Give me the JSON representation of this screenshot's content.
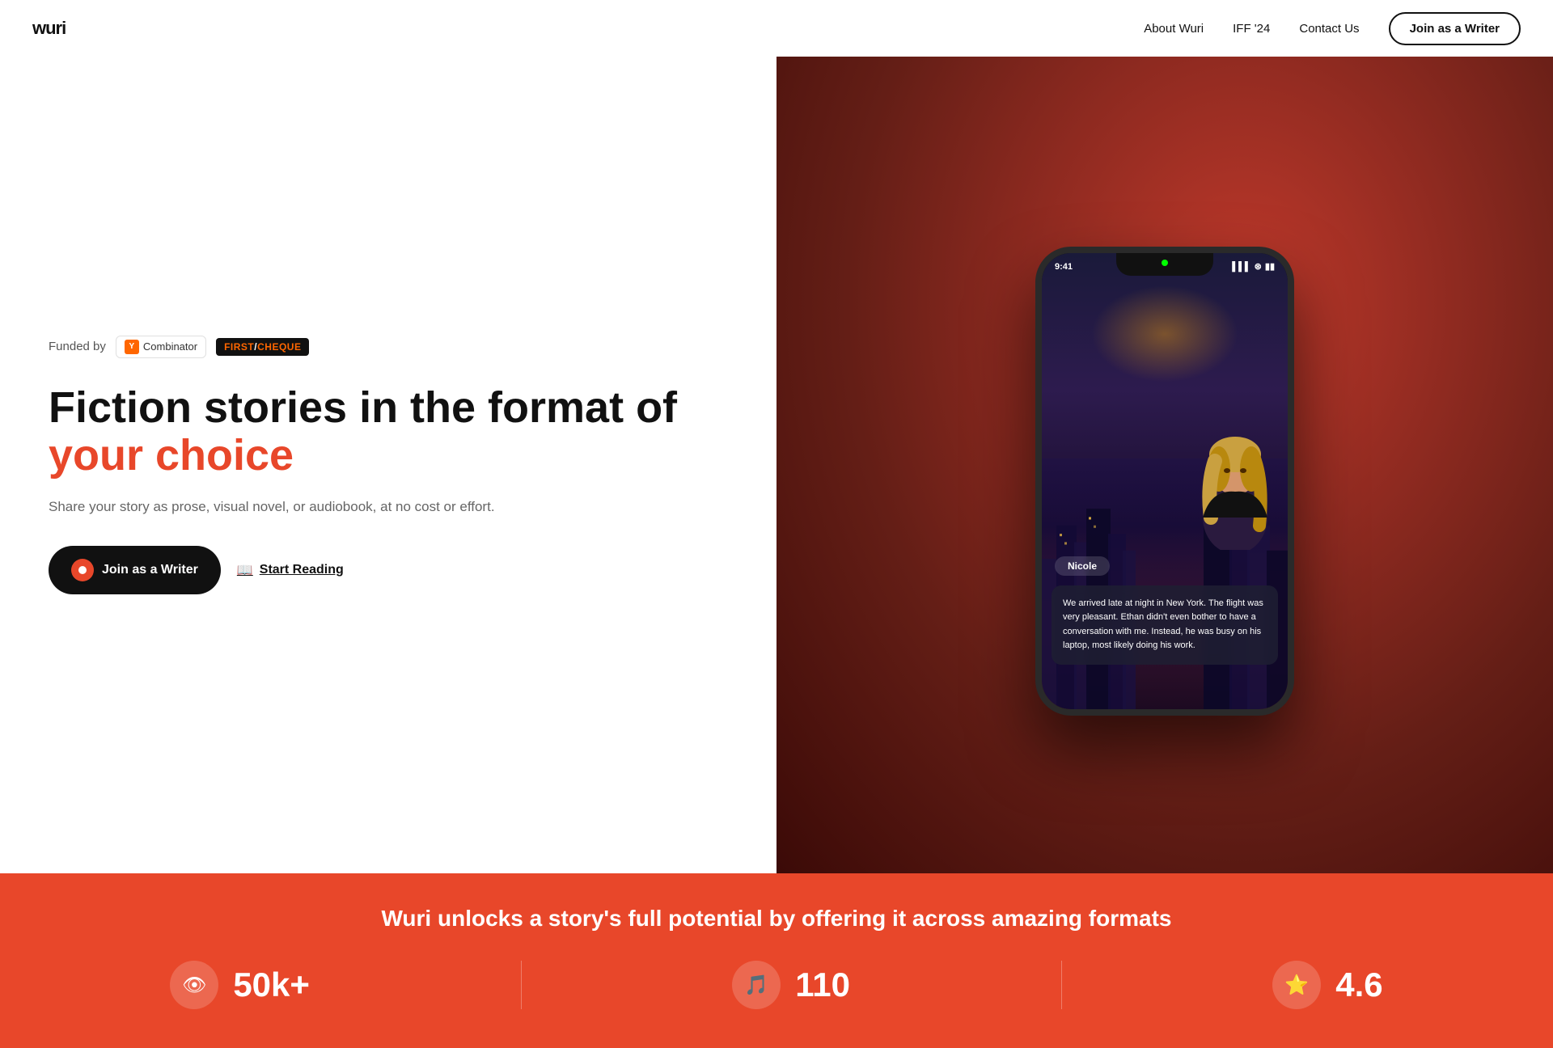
{
  "nav": {
    "logo": "wuri",
    "links": [
      {
        "label": "About Wuri",
        "href": "#"
      },
      {
        "label": "IFF '24",
        "href": "#"
      },
      {
        "label": "Contact Us",
        "href": "#"
      }
    ],
    "cta": "Join as a Writer"
  },
  "hero": {
    "funded_label": "Funded by",
    "yc_label": "Combinator",
    "fc_label_first": "FIRST",
    "fc_label_second": "CHEQUE",
    "headline_main": "Fiction stories in the format of ",
    "headline_highlight": "your choice",
    "subtext": "Share your story as prose, visual novel, or audiobook, at no cost or effort.",
    "btn_writer": "Join as a Writer",
    "btn_reading": "Start Reading"
  },
  "phone": {
    "time": "9:41",
    "character_name": "Nicole",
    "dialog": "We arrived late at night in New York. The flight was very pleasant. Ethan didn't even bother to have a conversation with me. Instead, he was busy on his laptop, most likely doing his work."
  },
  "bottom": {
    "tagline": "Wuri unlocks a story's full potential by offering it across amazing formats",
    "stats": [
      {
        "icon": "👁",
        "value": "50k+"
      },
      {
        "icon": "🎵",
        "value": "110"
      },
      {
        "icon": "⭐",
        "value": "4.6"
      }
    ]
  }
}
